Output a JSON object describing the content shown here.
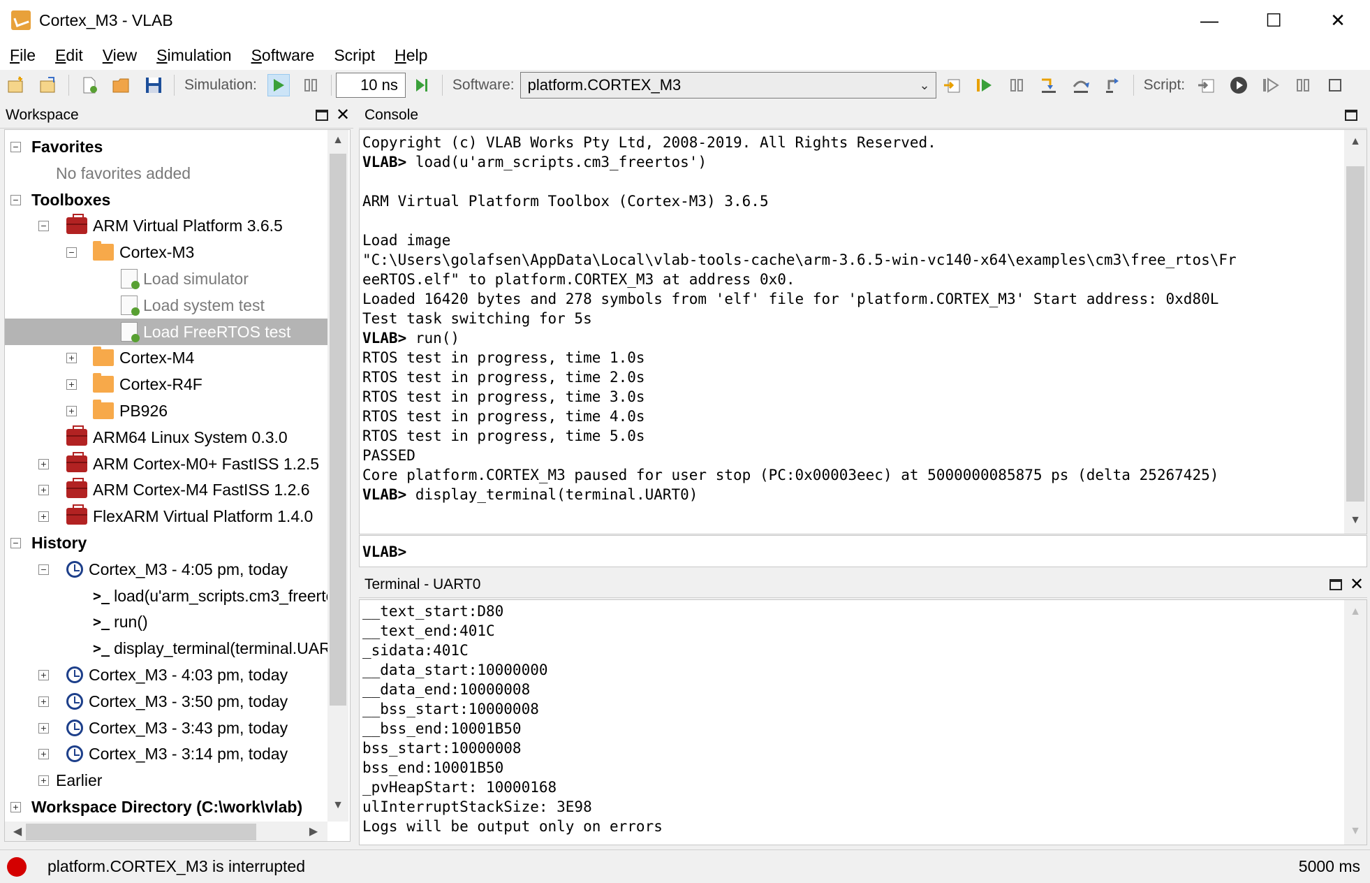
{
  "window": {
    "title": "Cortex_M3 - VLAB",
    "minimize_glyph": "—",
    "maximize_glyph": "☐",
    "close_glyph": "✕"
  },
  "menu": [
    {
      "label": "File",
      "u": "F",
      "rest": "ile"
    },
    {
      "label": "Edit",
      "u": "E",
      "rest": "dit"
    },
    {
      "label": "View",
      "u": "V",
      "rest": "iew"
    },
    {
      "label": "Simulation",
      "u": "S",
      "rest": "imulation"
    },
    {
      "label": "Software",
      "u": "S",
      "rest": "oftware"
    },
    {
      "label": "Script",
      "u": "",
      "rest": "Script"
    },
    {
      "label": "Help",
      "u": "H",
      "rest": "elp"
    }
  ],
  "toolbar": {
    "simulation_label": "Simulation:",
    "time_value": "10 ns",
    "software_label": "Software:",
    "software_selected": "platform.CORTEX_M3",
    "script_label": "Script:"
  },
  "workspace": {
    "title": "Workspace",
    "tree": [
      {
        "id": "favorites",
        "label": "Favorites"
      },
      {
        "id": "no-favorites",
        "label": "No favorites added"
      },
      {
        "id": "toolboxes",
        "label": "Toolboxes"
      },
      {
        "id": "arm-vp",
        "label": "ARM Virtual Platform 3.6.5"
      },
      {
        "id": "cortex-m3",
        "label": "Cortex-M3"
      },
      {
        "id": "load-simulator",
        "label": "Load simulator"
      },
      {
        "id": "load-system-test",
        "label": "Load system test"
      },
      {
        "id": "load-freertos-test",
        "label": "Load FreeRTOS test"
      },
      {
        "id": "cortex-m4",
        "label": "Cortex-M4"
      },
      {
        "id": "cortex-r4f",
        "label": "Cortex-R4F"
      },
      {
        "id": "pb926",
        "label": "PB926"
      },
      {
        "id": "arm64-linux",
        "label": "ARM64 Linux System 0.3.0"
      },
      {
        "id": "m0plus-fastiss",
        "label": "ARM Cortex-M0+ FastISS 1.2.5"
      },
      {
        "id": "m4-fastiss",
        "label": "ARM Cortex-M4 FastISS 1.2.6"
      },
      {
        "id": "flexarm",
        "label": "FlexARM Virtual Platform 1.4.0"
      },
      {
        "id": "history",
        "label": "History"
      },
      {
        "id": "hist-405",
        "label": "Cortex_M3 - 4:05 pm, today"
      },
      {
        "id": "cmd-load",
        "label": "load(u'arm_scripts.cm3_freerto"
      },
      {
        "id": "cmd-run",
        "label": "run()"
      },
      {
        "id": "cmd-display",
        "label": "display_terminal(terminal.UAR"
      },
      {
        "id": "hist-403",
        "label": "Cortex_M3 - 4:03 pm, today"
      },
      {
        "id": "hist-350",
        "label": "Cortex_M3 - 3:50 pm, today"
      },
      {
        "id": "hist-343",
        "label": "Cortex_M3 - 3:43 pm, today"
      },
      {
        "id": "hist-314",
        "label": "Cortex_M3 - 3:14 pm, today"
      },
      {
        "id": "earlier",
        "label": "Earlier"
      },
      {
        "id": "workspace-dir",
        "label": "Workspace Directory (C:\\work\\vlab)"
      }
    ]
  },
  "console": {
    "title": "Console",
    "lines": [
      "Copyright (c) VLAB Works Pty Ltd, 2008-2019. All Rights Reserved.",
      "VLAB> load(u'arm_scripts.cm3_freertos')",
      "",
      "ARM Virtual Platform Toolbox (Cortex-M3) 3.6.5",
      "",
      "Load image",
      "\"C:\\Users\\golafsen\\AppData\\Local\\vlab-tools-cache\\arm-3.6.5-win-vc140-x64\\examples\\cm3\\free_rtos\\Fr",
      "eeRTOS.elf\" to platform.CORTEX_M3 at address 0x0.",
      "Loaded 16420 bytes and 278 symbols from 'elf' file for 'platform.CORTEX_M3' Start address: 0xd80L",
      "Test task switching for 5s",
      "VLAB> run()",
      "RTOS test in progress, time 1.0s",
      "RTOS test in progress, time 2.0s",
      "RTOS test in progress, time 3.0s",
      "RTOS test in progress, time 4.0s",
      "RTOS test in progress, time 5.0s",
      "PASSED",
      "Core platform.CORTEX_M3 paused for user stop (PC:0x00003eec) at 5000000085875 ps (delta 25267425)",
      "VLAB> display_terminal(terminal.UART0)"
    ],
    "prompt": "VLAB>"
  },
  "terminal": {
    "title": "Terminal - UART0",
    "lines": [
      "__text_start:D80",
      "__text_end:401C",
      "_sidata:401C",
      "__data_start:10000000",
      "__data_end:10000008",
      "__bss_start:10000008",
      "__bss_end:10001B50",
      "bss_start:10000008",
      "bss_end:10001B50",
      "_pvHeapStart: 10000168",
      "ulInterruptStackSize: 3E98",
      "Logs will be output only on errors"
    ]
  },
  "status": {
    "text": "platform.CORTEX_M3 is interrupted",
    "time": "5000 ms",
    "indicator_color": "#d40000"
  }
}
